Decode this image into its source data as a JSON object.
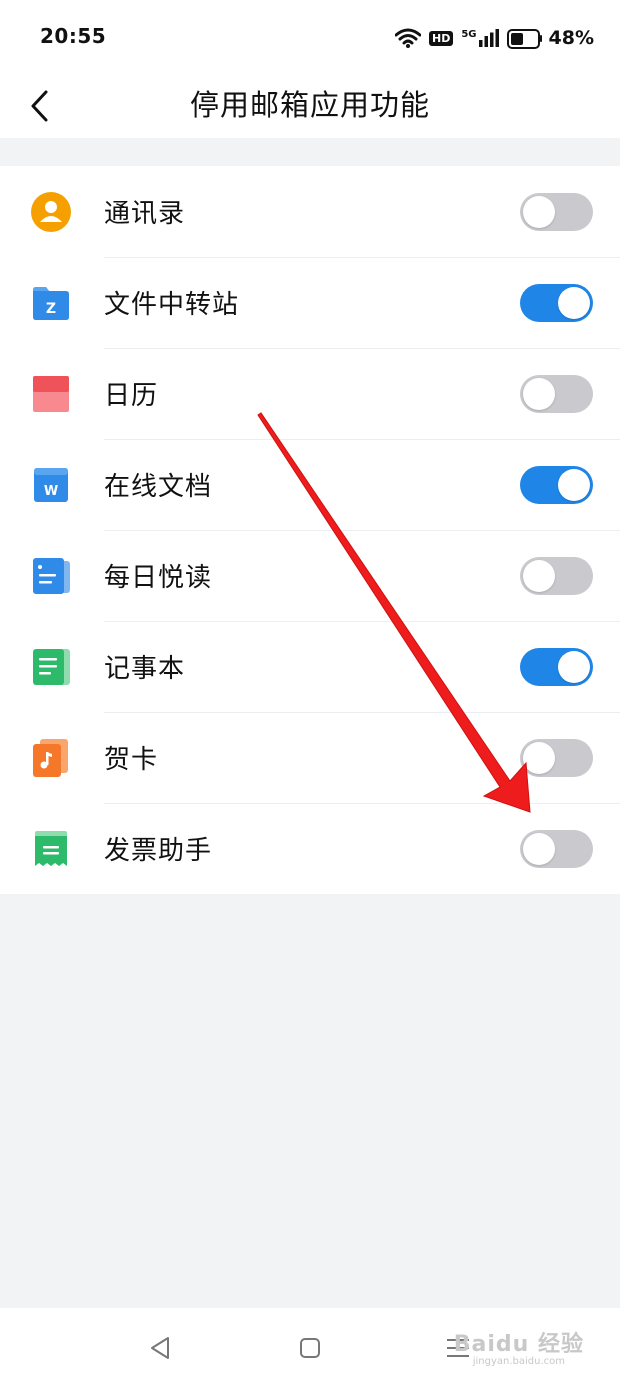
{
  "status_bar": {
    "time": "20:55",
    "hd_badge": "HD",
    "network": "5G",
    "battery": "48%",
    "battery_level": 0.48
  },
  "header": {
    "title": "停用邮箱应用功能"
  },
  "items": [
    {
      "label": "通讯录",
      "enabled": false,
      "icon": "contacts-icon",
      "color": "#f5a000"
    },
    {
      "label": "文件中转站",
      "enabled": true,
      "icon": "file-transfer-icon",
      "icon_letter": "Z",
      "color": "#2f8ae8"
    },
    {
      "label": "日历",
      "enabled": false,
      "icon": "calendar-icon",
      "color": "#f0525a"
    },
    {
      "label": "在线文档",
      "enabled": true,
      "icon": "online-doc-icon",
      "icon_letter": "W",
      "color": "#2f8ae8"
    },
    {
      "label": "每日悦读",
      "enabled": false,
      "icon": "daily-reading-icon",
      "color": "#2f8ae8"
    },
    {
      "label": "记事本",
      "enabled": true,
      "icon": "notepad-icon",
      "color": "#2dbb6b"
    },
    {
      "label": "贺卡",
      "enabled": false,
      "icon": "greeting-card-icon",
      "color": "#f5782a"
    },
    {
      "label": "发票助手",
      "enabled": false,
      "icon": "invoice-icon",
      "color": "#2dbb6b"
    }
  ],
  "colors": {
    "toggle_on": "#1f86e8",
    "toggle_off": "#c9c9ce",
    "arrow": "#ee1c1c"
  },
  "watermark": {
    "brand": "Baidu 经验",
    "url": "jingyan.baidu.com"
  }
}
